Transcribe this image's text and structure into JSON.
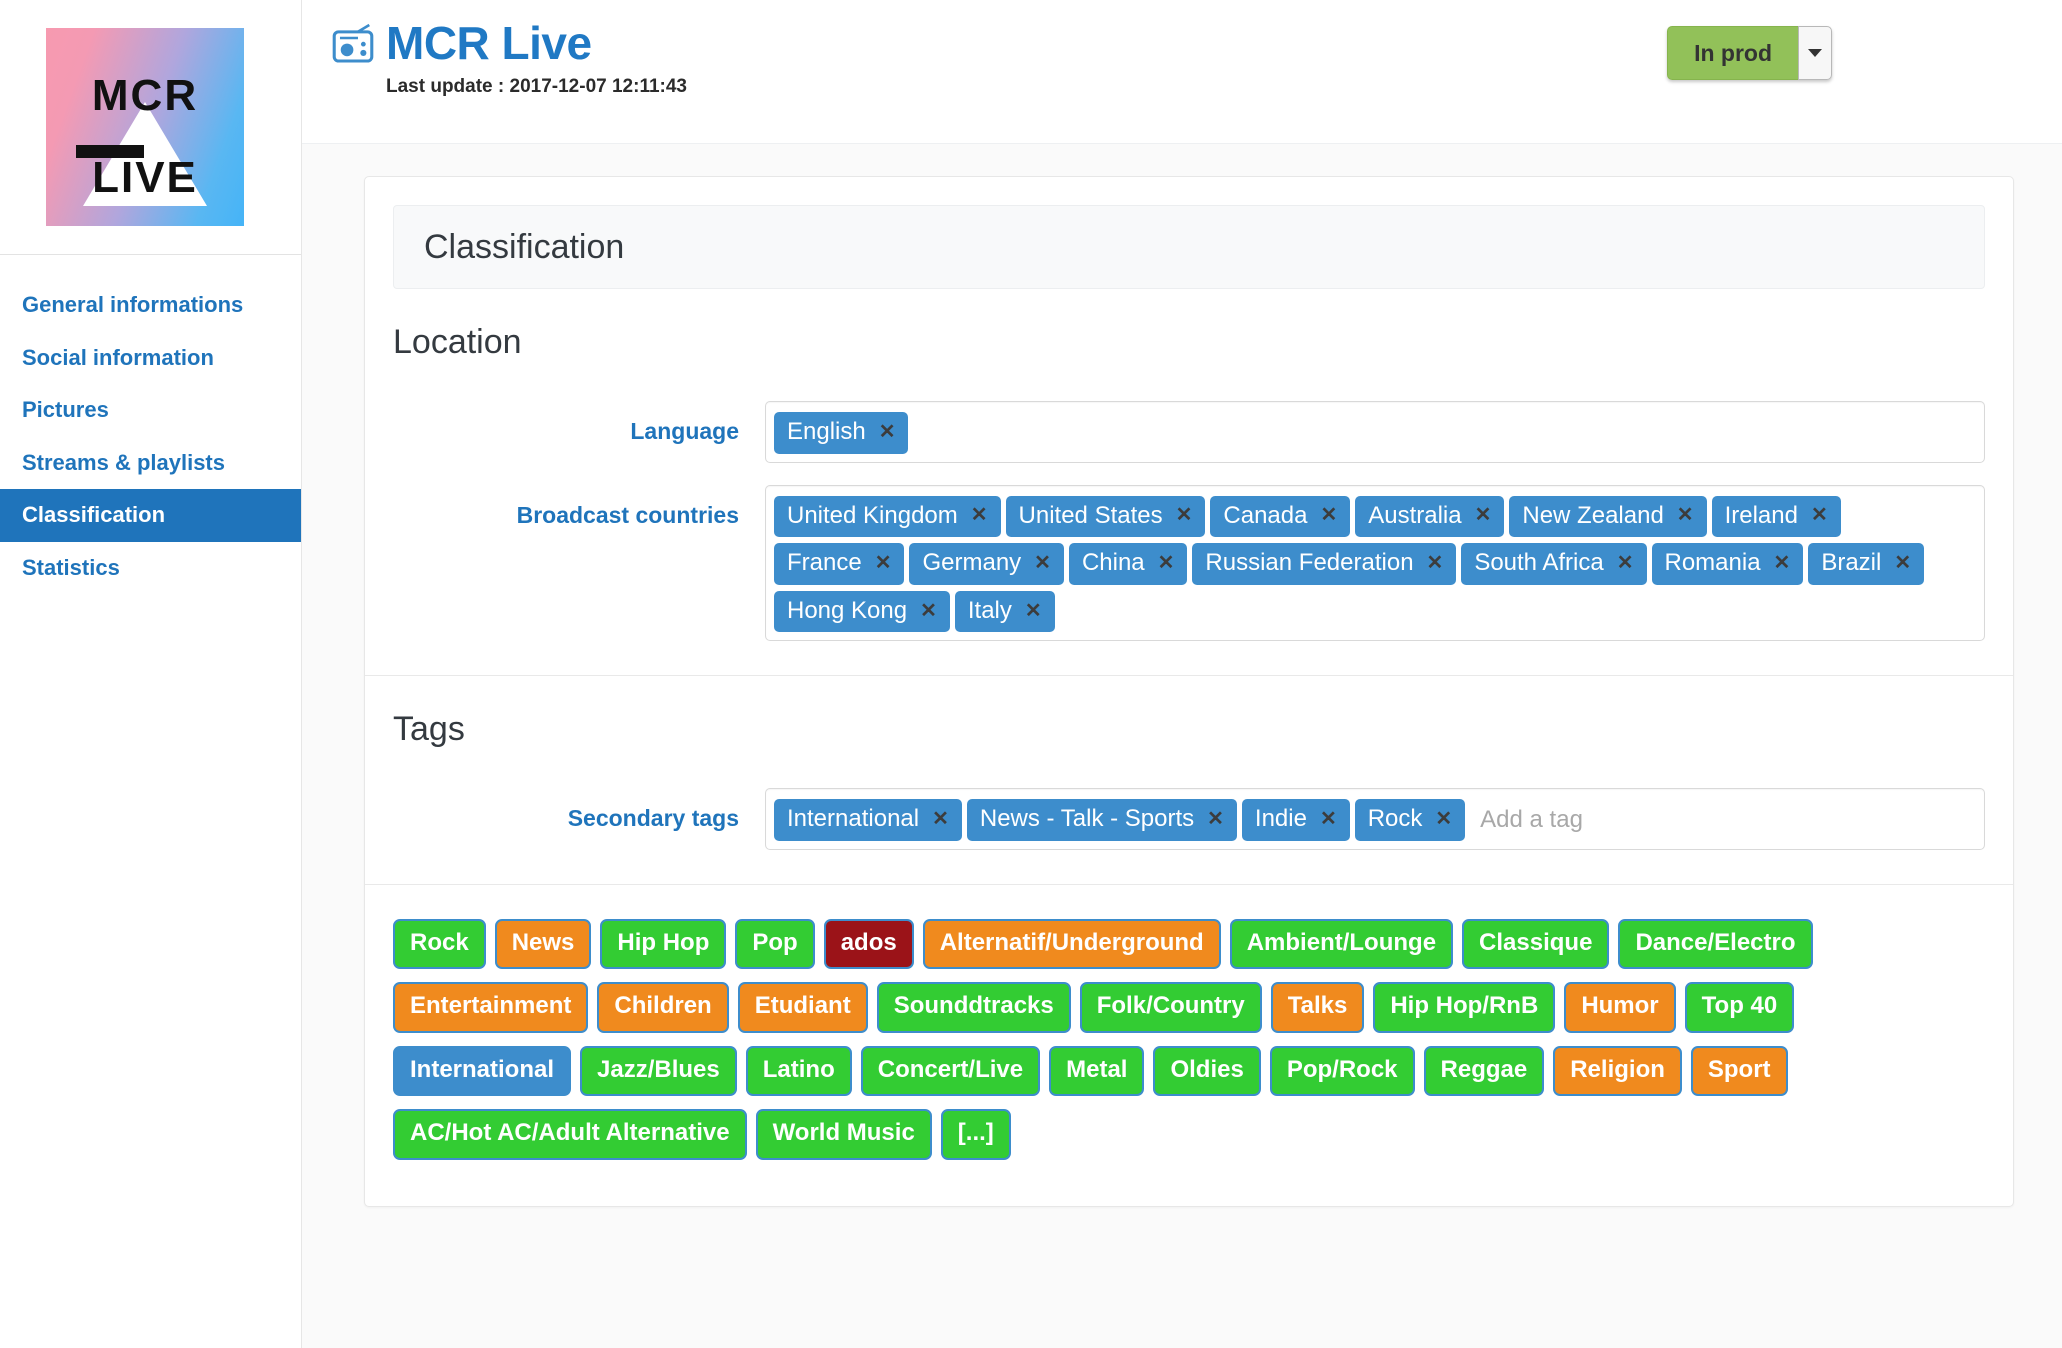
{
  "brand": {
    "logo_line1": "MCR",
    "logo_line2": "LIVE",
    "logo_alt": "mcr-live-logo"
  },
  "header": {
    "icon": "radio-icon",
    "title": "MCR Live",
    "last_update": "Last update : 2017-12-07 12:11:43",
    "status": {
      "label": "In prod",
      "caret_icon": "chevron-down-icon",
      "color": "#92c159"
    }
  },
  "sidebar": {
    "items": [
      {
        "label": "General informations",
        "active": false
      },
      {
        "label": "Social information",
        "active": false
      },
      {
        "label": "Pictures",
        "active": false
      },
      {
        "label": "Streams & playlists",
        "active": false
      },
      {
        "label": "Classification",
        "active": true
      },
      {
        "label": "Statistics",
        "active": false
      }
    ]
  },
  "panel": {
    "title": "Classification",
    "sections": {
      "location": {
        "title": "Location",
        "language": {
          "label": "Language",
          "tokens": [
            "English"
          ]
        },
        "broadcast_countries": {
          "label": "Broadcast countries",
          "tokens": [
            "United Kingdom",
            "United States",
            "Canada",
            "Australia",
            "New Zealand",
            "Ireland",
            "France",
            "Germany",
            "China",
            "Russian Federation",
            "South Africa",
            "Romania",
            "Brazil",
            "Hong Kong",
            "Italy"
          ]
        }
      },
      "tags": {
        "title": "Tags",
        "secondary_tags": {
          "label": "Secondary tags",
          "tokens": [
            "International",
            "News - Talk - Sports",
            "Indie",
            "Rock"
          ],
          "placeholder": "Add a tag",
          "value": ""
        }
      }
    }
  },
  "genres": [
    {
      "label": "Rock",
      "color": "green"
    },
    {
      "label": "News",
      "color": "orange"
    },
    {
      "label": "Hip Hop",
      "color": "green"
    },
    {
      "label": "Pop",
      "color": "green"
    },
    {
      "label": "ados",
      "color": "maroon"
    },
    {
      "label": "Alternatif/Underground",
      "color": "orange"
    },
    {
      "label": "Ambient/Lounge",
      "color": "green"
    },
    {
      "label": "Classique",
      "color": "green"
    },
    {
      "label": "Dance/Electro",
      "color": "green"
    },
    {
      "label": "Entertainment",
      "color": "orange"
    },
    {
      "label": "Children",
      "color": "orange"
    },
    {
      "label": "Etudiant",
      "color": "orange"
    },
    {
      "label": "Sounddtracks",
      "color": "green"
    },
    {
      "label": "Folk/Country",
      "color": "green"
    },
    {
      "label": "Talks",
      "color": "orange"
    },
    {
      "label": "Hip Hop/RnB",
      "color": "green"
    },
    {
      "label": "Humor",
      "color": "orange"
    },
    {
      "label": "Top 40",
      "color": "green"
    },
    {
      "label": "International",
      "color": "blue"
    },
    {
      "label": "Jazz/Blues",
      "color": "green"
    },
    {
      "label": "Latino",
      "color": "green"
    },
    {
      "label": "Concert/Live",
      "color": "green"
    },
    {
      "label": "Metal",
      "color": "green"
    },
    {
      "label": "Oldies",
      "color": "green"
    },
    {
      "label": "Pop/Rock",
      "color": "green"
    },
    {
      "label": "Reggae",
      "color": "green"
    },
    {
      "label": "Religion",
      "color": "orange"
    },
    {
      "label": "Sport",
      "color": "orange"
    },
    {
      "label": "AC/Hot AC/Adult Alternative",
      "color": "green"
    },
    {
      "label": "World Music",
      "color": "green"
    },
    {
      "label": "[...]",
      "color": "green"
    }
  ],
  "colors": {
    "accent_blue": "#1f74bb",
    "token_blue": "#3d8dcc",
    "genre_green": "#33cc33",
    "genre_orange": "#f08a1e",
    "genre_maroon": "#9b1318",
    "status_green": "#92c159"
  }
}
